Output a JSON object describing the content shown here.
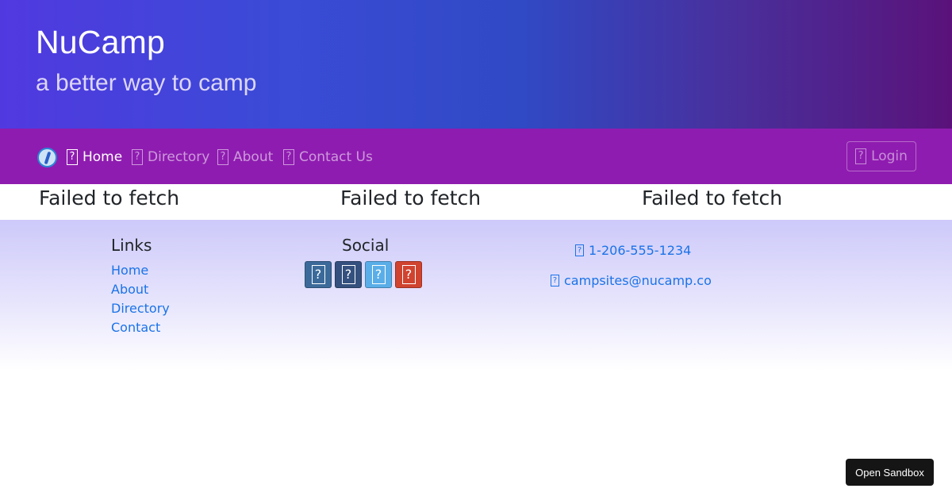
{
  "header": {
    "title": "NuCamp",
    "subtitle": "a better way to camp"
  },
  "nav": {
    "logo_icon": "nucamp-logo-icon",
    "items": [
      {
        "label": "Home",
        "icon": "missing-glyph-icon",
        "active": true
      },
      {
        "label": "Directory",
        "icon": "missing-glyph-icon",
        "active": false
      },
      {
        "label": "About",
        "icon": "missing-glyph-icon",
        "active": false
      },
      {
        "label": "Contact Us",
        "icon": "missing-glyph-icon",
        "active": false
      }
    ],
    "login_label": "Login",
    "glyph": "?"
  },
  "fetch_errors": [
    "Failed to fetch",
    "Failed to fetch",
    "Failed to fetch"
  ],
  "footer": {
    "links_heading": "Links",
    "links": [
      "Home",
      "About",
      "Directory",
      "Contact"
    ],
    "social_heading": "Social",
    "social_buttons": [
      {
        "icon": "missing-glyph-icon",
        "color": "#3b6a9a"
      },
      {
        "icon": "missing-glyph-icon",
        "color": "#34507e"
      },
      {
        "icon": "missing-glyph-icon",
        "color": "#5aaee8"
      },
      {
        "icon": "missing-glyph-icon",
        "color": "#d0432f"
      }
    ],
    "phone": "1-206-555-1234",
    "email": "campsites@nucamp.co"
  },
  "sandbox_button": "Open Sandbox",
  "colors": {
    "navbar": "#8f1cb0",
    "link": "#1a73e8"
  }
}
